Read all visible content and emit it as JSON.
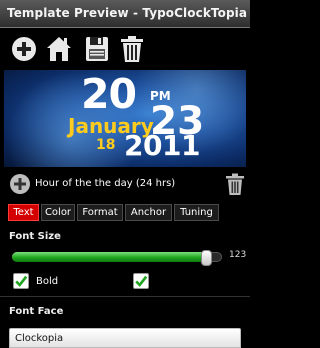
{
  "window": {
    "title": "Template Preview - TypoClockTopia"
  },
  "toolbar": {
    "icons": [
      "add-icon",
      "home-icon",
      "save-icon",
      "trash-icon"
    ]
  },
  "preview": {
    "hour": "20",
    "ampm": "PM",
    "month": "January",
    "date": "23",
    "weekday": "18",
    "year": "2011",
    "colors": {
      "primary_text": "#ffffff",
      "accent_text": "#ffcc1e",
      "background": "#1d4f9c"
    }
  },
  "layer": {
    "name": "Hour of the the day (24 hrs)"
  },
  "tabs": [
    {
      "label": "Text",
      "active": true
    },
    {
      "label": "Color",
      "active": false
    },
    {
      "label": "Format",
      "active": false
    },
    {
      "label": "Anchor",
      "active": false
    },
    {
      "label": "Tuning",
      "active": false
    }
  ],
  "font_size": {
    "label": "Font Size",
    "value": "123",
    "fill_fraction": 0.95
  },
  "checkboxes": {
    "bold": {
      "label": "Bold",
      "checked": true
    },
    "second": {
      "label": "",
      "checked": true
    }
  },
  "font_face": {
    "label": "Font Face",
    "value": "Clockopia"
  },
  "colors": {
    "tab_active": "#d40000",
    "slider_fill": "#1fa61f",
    "check_mark": "#1fa61f"
  }
}
